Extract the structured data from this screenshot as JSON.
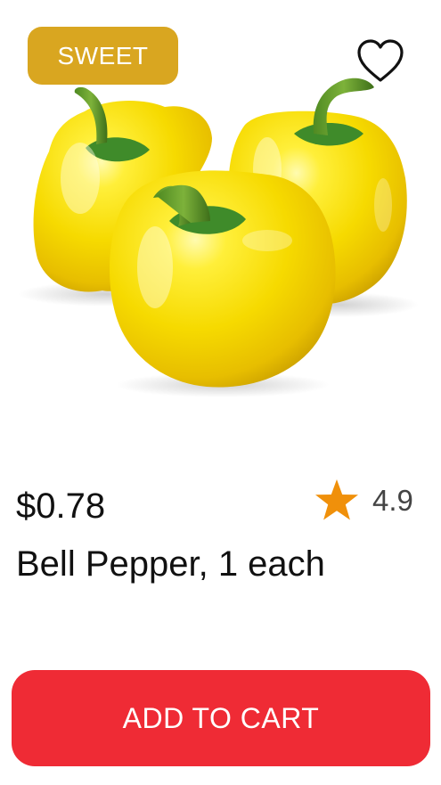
{
  "product": {
    "badge": "SWEET",
    "price": "$0.78",
    "rating": "4.9",
    "name": "Bell Pepper, 1 each",
    "add_to_cart_label": "ADD TO CART",
    "image_icon": "yellow-bell-peppers-image"
  },
  "icons": {
    "favorite": "heart-outline-icon",
    "rating": "star-icon"
  },
  "colors": {
    "badge_bg": "#D9A620",
    "button_bg": "#EF2B35",
    "star": "#F0900A",
    "pepper_yellow": "#F5D800"
  }
}
